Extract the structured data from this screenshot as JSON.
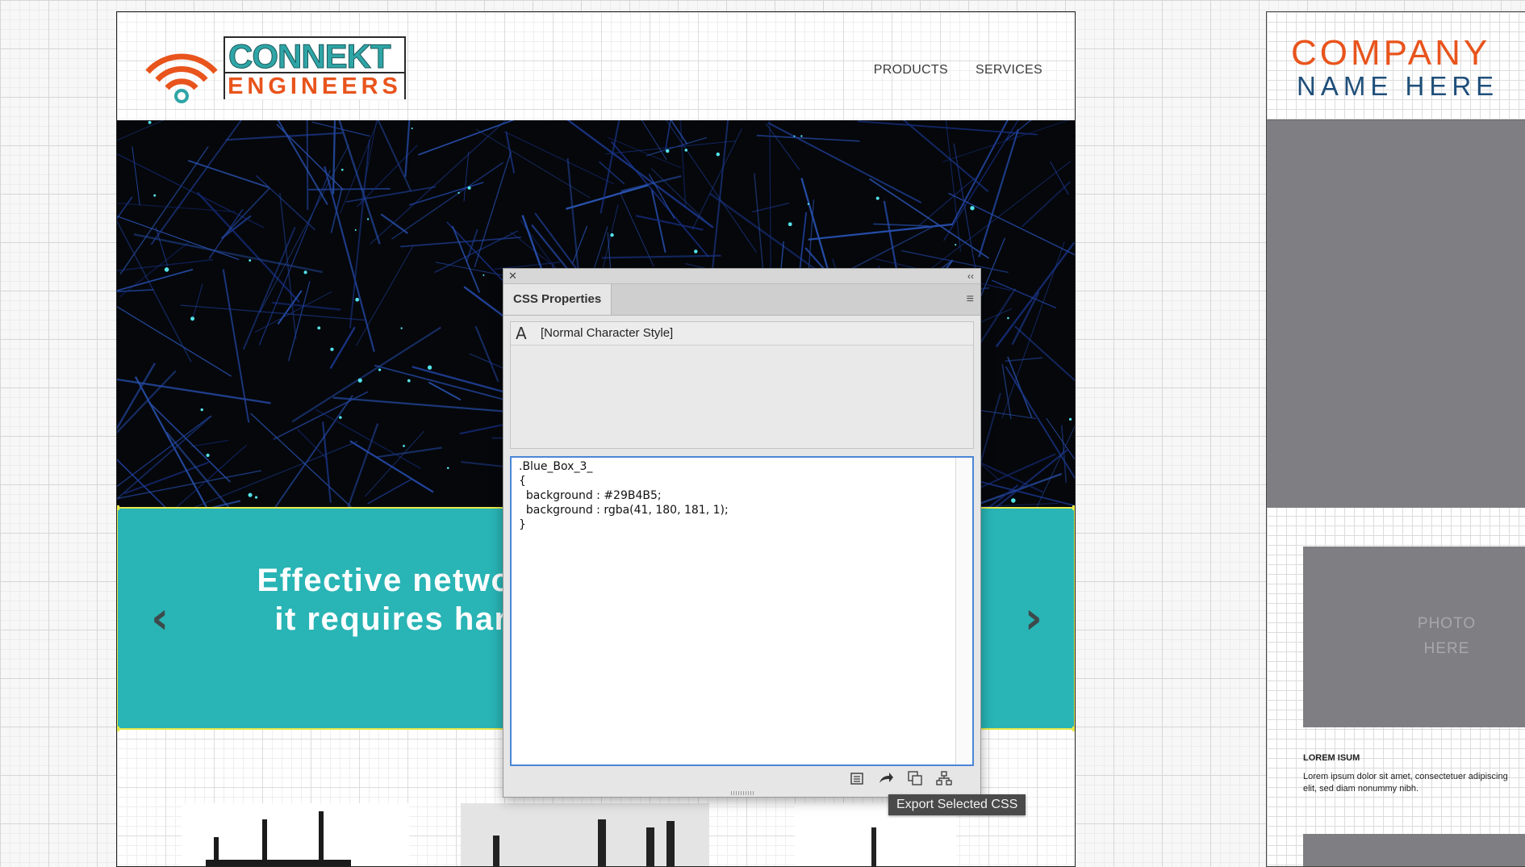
{
  "logo": {
    "word1": "CONNEKT",
    "word2": "ENGINEERS",
    "wifi_color": "#e8541c",
    "teal_color": "#2ea5a6"
  },
  "nav": {
    "products": "PRODUCTS",
    "services": "SERVICES"
  },
  "banner": {
    "background": "#29B4B5",
    "line1": "Effective networ",
    "line2": "it requires har",
    "prev_icon": "‹",
    "next_icon": "›"
  },
  "css_panel": {
    "close_icon": "✕",
    "collapse_icon": "‹‹",
    "tab_label": "CSS Properties",
    "menu_icon": "≡",
    "style_icon": "A",
    "style_name": "[Normal Character Style]",
    "css_code": ".Blue_Box_3_\n{\n  background : #29B4B5;\n  background : rgba(41, 180, 181, 1);\n}",
    "tooltip": "Export Selected CSS"
  },
  "right_board": {
    "company_line1": "COMPANY",
    "company_line2": "NAME HERE",
    "photo_line1": "PHOTO",
    "photo_line2": "HERE",
    "lorem_title": "LOREM ISUM",
    "lorem_body_line1": "Lorem ipsum dolor sit amet, consectetuer adipiscing",
    "lorem_body_line2": "elit, sed diam nonummy nibh."
  }
}
